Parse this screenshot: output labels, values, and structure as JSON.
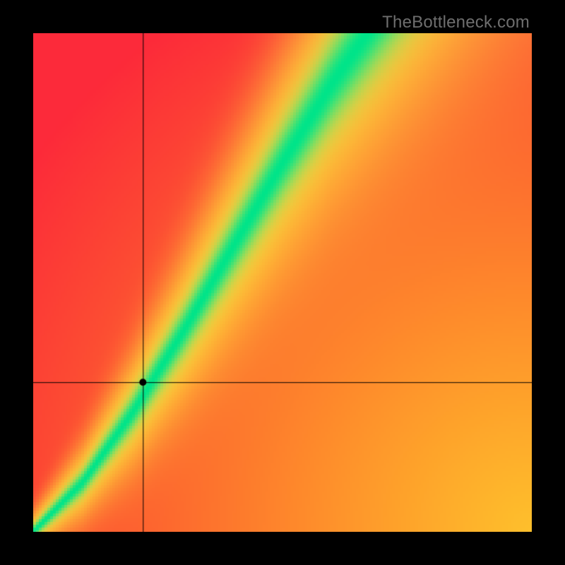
{
  "watermark": "TheBottleneck.com",
  "chart_data": {
    "type": "heatmap",
    "title": "",
    "xlabel": "",
    "ylabel": "",
    "xlim": [
      0,
      1
    ],
    "ylim": [
      0,
      1
    ],
    "marker": {
      "x": 0.22,
      "y": 0.3
    },
    "ridge": [
      {
        "x": 0.0,
        "y": 0.0
      },
      {
        "x": 0.1,
        "y": 0.1
      },
      {
        "x": 0.2,
        "y": 0.24
      },
      {
        "x": 0.3,
        "y": 0.4
      },
      {
        "x": 0.4,
        "y": 0.57
      },
      {
        "x": 0.5,
        "y": 0.74
      },
      {
        "x": 0.6,
        "y": 0.9
      },
      {
        "x": 0.67,
        "y": 1.0
      }
    ],
    "ridge_width_start": 0.01,
    "ridge_width_end": 0.1,
    "colors": {
      "low": "#fc2a3a",
      "mid": "#ff9a1f",
      "high": "#ffe63a",
      "peak": "#00e58a"
    },
    "pixelation": 4,
    "crosshair": true
  }
}
